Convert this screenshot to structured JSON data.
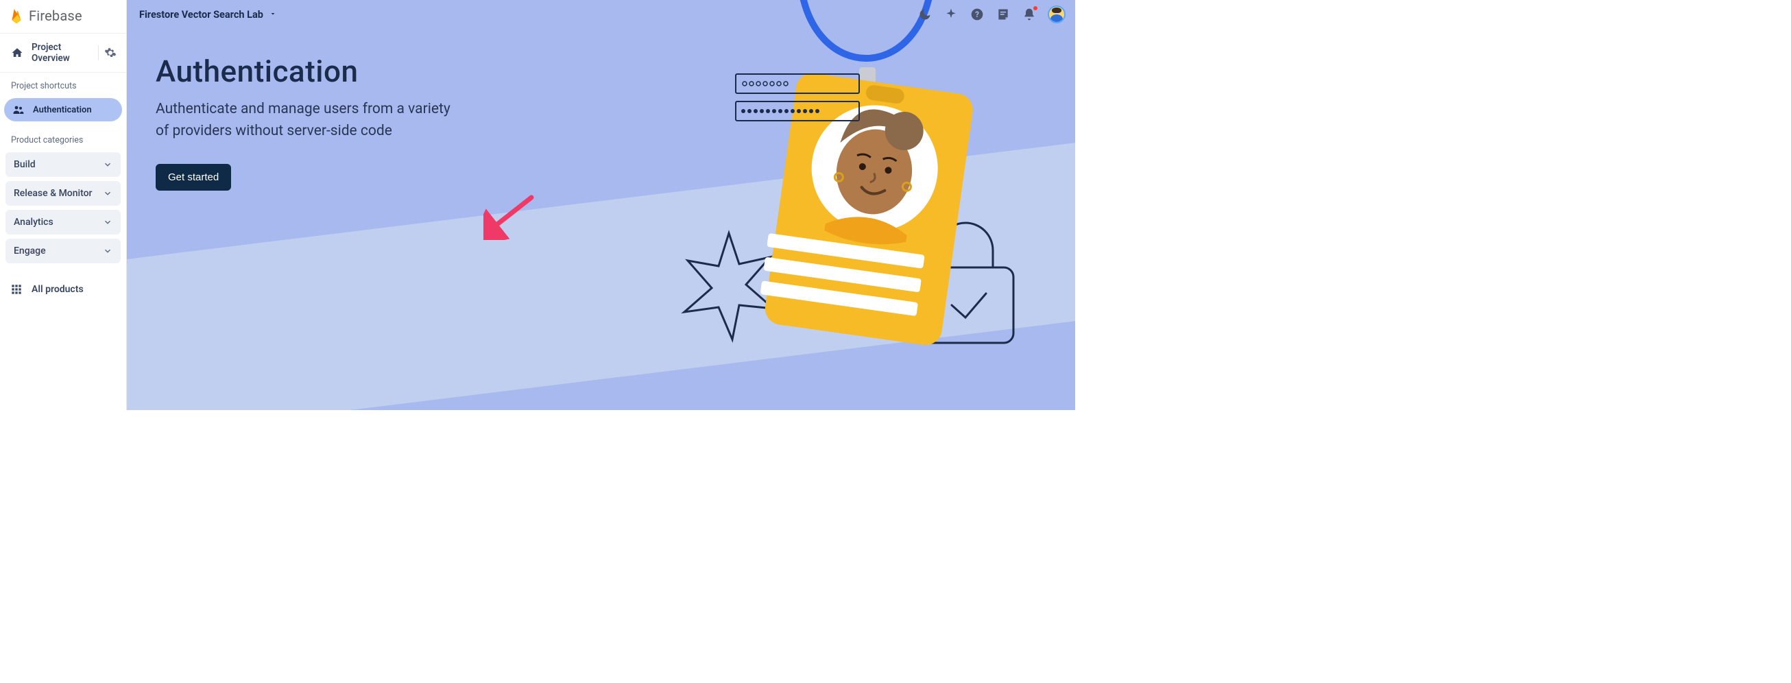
{
  "brand": {
    "name": "Firebase"
  },
  "sidebar": {
    "overview_label": "Project Overview",
    "shortcuts_label": "Project shortcuts",
    "shortcuts": [
      {
        "label": "Authentication",
        "icon": "people-icon"
      }
    ],
    "categories_label": "Product categories",
    "categories": [
      {
        "label": "Build"
      },
      {
        "label": "Release & Monitor"
      },
      {
        "label": "Analytics"
      },
      {
        "label": "Engage"
      }
    ],
    "all_products_label": "All products"
  },
  "topbar": {
    "project_name": "Firestore Vector Search Lab"
  },
  "hero": {
    "title": "Authentication",
    "subtitle": "Authenticate and manage users from a variety of providers without server-side code",
    "cta_label": "Get started"
  },
  "colors": {
    "hero_bg": "#a7b9ee",
    "accent_yellow": "#f6bb27",
    "cta_bg": "#0e2a47",
    "arrow": "#ef3a67"
  }
}
